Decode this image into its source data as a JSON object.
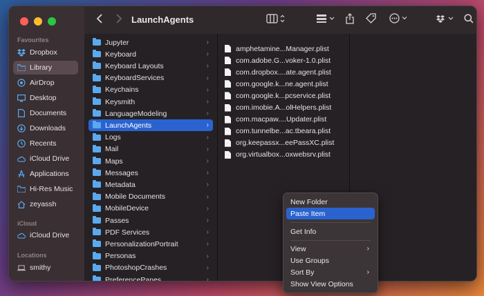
{
  "window": {
    "title": "LaunchAgents",
    "traffic_lights": [
      "#fe5f57",
      "#febc2e",
      "#28c840"
    ]
  },
  "toolbar": {
    "back_icon": "chevron-left-icon",
    "forward_icon": "chevron-right-icon",
    "view_icon": "column-view-icon",
    "group_icon": "group-icon",
    "share_icon": "share-icon",
    "tag_icon": "tag-icon",
    "more_icon": "ellipsis-circle-icon",
    "dropbox_icon": "dropbox-icon",
    "search_icon": "search-icon"
  },
  "sidebar": {
    "favourites_title": "Favourites",
    "favourites": [
      {
        "label": "Dropbox",
        "icon": "dropbox-icon"
      },
      {
        "label": "Library",
        "icon": "folder-icon",
        "selected": true
      },
      {
        "label": "AirDrop",
        "icon": "airdrop-icon"
      },
      {
        "label": "Desktop",
        "icon": "desktop-icon"
      },
      {
        "label": "Documents",
        "icon": "document-icon"
      },
      {
        "label": "Downloads",
        "icon": "download-icon"
      },
      {
        "label": "Recents",
        "icon": "clock-icon"
      },
      {
        "label": "iCloud Drive",
        "icon": "cloud-icon"
      },
      {
        "label": "Applications",
        "icon": "applications-icon"
      },
      {
        "label": "Hi-Res Music",
        "icon": "folder-icon"
      },
      {
        "label": "zeyassh",
        "icon": "home-icon"
      }
    ],
    "icloud_title": "iCloud",
    "icloud": [
      {
        "label": "iCloud Drive",
        "icon": "cloud-icon"
      }
    ],
    "locations_title": "Locations",
    "locations": [
      {
        "label": "smithy",
        "icon": "laptop-icon"
      }
    ]
  },
  "column1": {
    "items": [
      {
        "label": "Jupyter"
      },
      {
        "label": "Keyboard"
      },
      {
        "label": "Keyboard Layouts"
      },
      {
        "label": "KeyboardServices"
      },
      {
        "label": "Keychains"
      },
      {
        "label": "Keysmith"
      },
      {
        "label": "LanguageModeling"
      },
      {
        "label": "LaunchAgents",
        "selected": true
      },
      {
        "label": "Logs"
      },
      {
        "label": "Mail"
      },
      {
        "label": "Maps"
      },
      {
        "label": "Messages"
      },
      {
        "label": "Metadata"
      },
      {
        "label": "Mobile Documents"
      },
      {
        "label": "MobileDevice"
      },
      {
        "label": "Passes"
      },
      {
        "label": "PDF Services"
      },
      {
        "label": "PersonalizationPortrait"
      },
      {
        "label": "Personas"
      },
      {
        "label": "PhotoshopCrashes"
      },
      {
        "label": "PreferencePanes"
      }
    ]
  },
  "column2": {
    "files": [
      "amphetamine...Manager.plist",
      "com.adobe.G...voker-1.0.plist",
      "com.dropbox....ate.agent.plist",
      "com.google.k...ne.agent.plist",
      "com.google.k...pcservice.plist",
      "com.imobie.A...olHelpers.plist",
      "com.macpaw....Updater.plist",
      "com.tunnelbe...ac.tbeara.plist",
      "org.keepassx...eePassXC.plist",
      "org.virtualbox...oxwebsrv.plist"
    ]
  },
  "context_menu": {
    "new_folder": "New Folder",
    "paste_item": "Paste Item",
    "get_info": "Get Info",
    "show_view": "View",
    "use_groups": "Use Groups",
    "sort_by": "Sort By",
    "show_view_options": "Show View Options"
  },
  "colors": {
    "accent": "#2a63cf",
    "folder": "#5aa9ef"
  }
}
